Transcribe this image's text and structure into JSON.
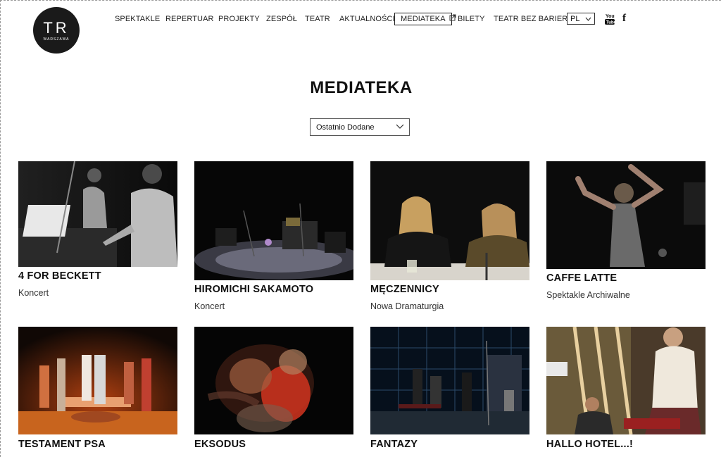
{
  "logo": {
    "text": "TR",
    "subtext": "WARSZAWA"
  },
  "nav": {
    "items": [
      "SPEKTAKLE",
      "REPERTUAR",
      "PROJEKTY",
      "ZESPÓŁ",
      "TEATR",
      "AKTUALNOŚCI",
      "MEDIATEKA",
      "BILETY",
      "TEATR BEZ BARIER"
    ],
    "active": "MEDIATEKA",
    "language": "PL"
  },
  "page": {
    "title": "MEDIATEKA"
  },
  "sort": {
    "selected": "Ostatnio Dodane"
  },
  "cards": [
    {
      "title": "4 FOR BECKETT",
      "category": "Koncert"
    },
    {
      "title": "HIROMICHI SAKAMOTO",
      "category": "Koncert"
    },
    {
      "title": "MĘCZENNICY",
      "category": "Nowa Dramaturgia"
    },
    {
      "title": "CAFFE LATTE",
      "category": "Spektakle Archiwalne"
    },
    {
      "title": "TESTAMENT PSA",
      "category": ""
    },
    {
      "title": "EKSODUS",
      "category": ""
    },
    {
      "title": "FANTAZY",
      "category": ""
    },
    {
      "title": "HALLO HOTEL...!",
      "category": ""
    }
  ],
  "colors": {
    "text": "#111111",
    "background": "#ffffff",
    "logo_bg": "#1a1a1a"
  },
  "icons": [
    "external-link-icon",
    "youtube-icon",
    "facebook-icon",
    "chevron-down-icon"
  ]
}
